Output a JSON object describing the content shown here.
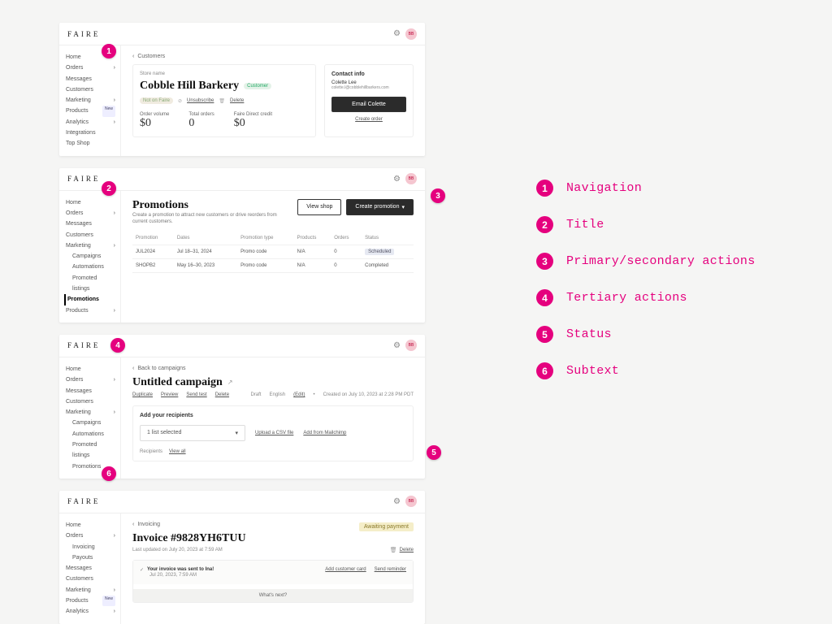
{
  "brand": "FAIRE",
  "legend": [
    {
      "n": "1",
      "label": "Navigation"
    },
    {
      "n": "2",
      "label": "Title"
    },
    {
      "n": "3",
      "label": "Primary/secondary actions"
    },
    {
      "n": "4",
      "label": "Tertiary actions"
    },
    {
      "n": "5",
      "label": "Status"
    },
    {
      "n": "6",
      "label": "Subtext"
    }
  ],
  "p1": {
    "crumb": "Customers",
    "storename_label": "Store name",
    "title": "Cobble Hill Barkery",
    "tag1": "Customer",
    "tag2": "Not on Faire",
    "unsubscribe": "Unsubscribe",
    "delete": "Delete",
    "stats": [
      {
        "label": "Order volume",
        "val": "$0"
      },
      {
        "label": "Total orders",
        "val": "0"
      },
      {
        "label": "Faire Direct credit",
        "val": "$0"
      }
    ],
    "contact_header": "Contact info",
    "contact_name": "Colette Lee",
    "contact_email": "colette.l@cobblehillbarkers.com",
    "email_btn": "Email Colette",
    "create_order": "Create order",
    "sidebar": [
      "Home",
      "Orders",
      "Messages",
      "Customers",
      "Marketing",
      "Products",
      "Analytics",
      "Integrations",
      "Top Shop"
    ],
    "products_badge": "New"
  },
  "p2": {
    "title": "Promotions",
    "desc": "Create a promotion to attract new customers or drive reorders from current customers.",
    "view_shop": "View shop",
    "create_promo": "Create promotion",
    "cols": [
      "Promotion",
      "Dates",
      "Promotion type",
      "Products",
      "Orders",
      "Status"
    ],
    "rows": [
      {
        "name": "JUL2024",
        "dates": "Jul 18–31, 2024",
        "type": "Promo code",
        "products": "N/A",
        "orders": "0",
        "status": "Scheduled"
      },
      {
        "name": "SHOPB2",
        "dates": "May 16–30, 2023",
        "type": "Promo code",
        "products": "N/A",
        "orders": "0",
        "status": "Completed"
      }
    ],
    "sidebar": [
      "Home",
      "Orders",
      "Messages",
      "Customers",
      "Marketing",
      "Campaigns",
      "Automations",
      "Promoted listings",
      "Promotions",
      "Products"
    ]
  },
  "p3": {
    "crumb": "Back to campaigns",
    "title": "Untitled campaign",
    "tertiary": [
      "Duplicate",
      "Preview",
      "Send test",
      "Delete"
    ],
    "meta_draft": "Draft",
    "meta_lang": "English",
    "meta_edit": "(Edit)",
    "meta_created": "Created on July 10, 2023 at 2:28 PM PDT",
    "add_recipients": "Add your recipients",
    "select_label": "1 list selected",
    "upload": "Upload a CSV file",
    "mailchimp": "Add from Mailchimp",
    "recipients": "Recipients",
    "view_all": "View all",
    "sidebar": [
      "Home",
      "Orders",
      "Messages",
      "Customers",
      "Marketing",
      "Campaigns",
      "Automations",
      "Promoted listings",
      "Promotions"
    ]
  },
  "p4": {
    "crumb": "Invoicing",
    "title": "Invoice #9828YH6TUU",
    "subtext": "Last updated on July 20, 2023 at 7:59 AM",
    "status": "Awaiting payment",
    "delete": "Delete",
    "notice_title": "Your invoice was sent to Ina!",
    "notice_time": "Jul 20, 2023, 7:59 AM",
    "add_card": "Add customer card",
    "send_reminder": "Send reminder",
    "next": "What's next?",
    "sidebar": [
      "Home",
      "Orders",
      "Invoicing",
      "Payouts",
      "Messages",
      "Customers",
      "Marketing",
      "Products",
      "Analytics"
    ],
    "products_badge": "New"
  }
}
